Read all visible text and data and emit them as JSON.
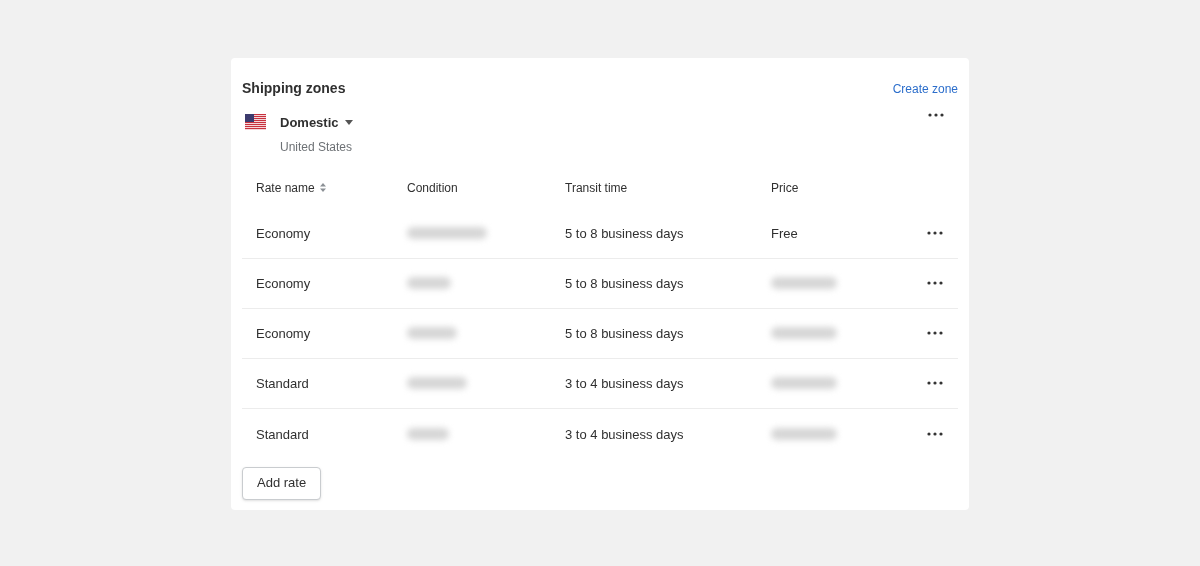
{
  "card": {
    "title": "Shipping zones",
    "action": "Create zone"
  },
  "zone": {
    "name": "Domestic",
    "country": "United States"
  },
  "table": {
    "columns": [
      "Rate name",
      "Condition",
      "Transit time",
      "Price"
    ],
    "rows": [
      {
        "rate_name": "Economy",
        "condition": {
          "redacted": true
        },
        "transit_time": "5 to 8 business days",
        "price": {
          "redacted": false,
          "text": "Free"
        }
      },
      {
        "rate_name": "Economy",
        "condition": {
          "redacted": true
        },
        "transit_time": "5 to 8 business days",
        "price": {
          "redacted": true
        }
      },
      {
        "rate_name": "Economy",
        "condition": {
          "redacted": true
        },
        "transit_time": "5 to 8 business days",
        "price": {
          "redacted": true
        }
      },
      {
        "rate_name": "Standard",
        "condition": {
          "redacted": true
        },
        "transit_time": "3 to 4 business days",
        "price": {
          "redacted": true
        }
      },
      {
        "rate_name": "Standard",
        "condition": {
          "redacted": true
        },
        "transit_time": "3 to 4 business days",
        "price": {
          "redacted": true
        }
      }
    ]
  },
  "add_button": "Add rate"
}
